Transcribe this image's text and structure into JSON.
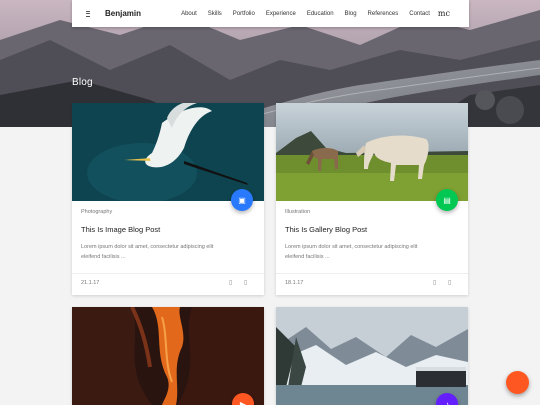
{
  "nav": {
    "brand": "Benjamin",
    "links": [
      "About",
      "Skills",
      "Portfolio",
      "Experience",
      "Education",
      "Blog",
      "References",
      "Contact"
    ],
    "logo_text": "mc"
  },
  "hero": {
    "title": "Blog"
  },
  "posts": [
    {
      "category": "Photography",
      "title": "This Is Image Blog Post",
      "excerpt_line1": "Lorem ipsum dolor sit amet, consectetur adipiscing elit",
      "excerpt_line2": "eleifend facilisis ...",
      "date": "21.1.17",
      "fab_color": "#2979ff"
    },
    {
      "category": "Illustration",
      "title": "This Is Gallery Blog Post",
      "excerpt_line1": "Lorem ipsum dolor sit amet, consectetur adipiscing elit",
      "excerpt_line2": "eleifend facilisis ...",
      "date": "18.1.17",
      "fab_color": "#00c853"
    },
    {
      "fab_color": "#ff5722"
    },
    {
      "fab_color": "#651fff"
    }
  ],
  "icons": {
    "menu": "hamburger-icon",
    "fab": "post-type-icon",
    "comment": "comment-icon",
    "share": "share-icon",
    "floating": "settings-fab"
  },
  "colors": {
    "floating_fab": "#ff5722"
  }
}
